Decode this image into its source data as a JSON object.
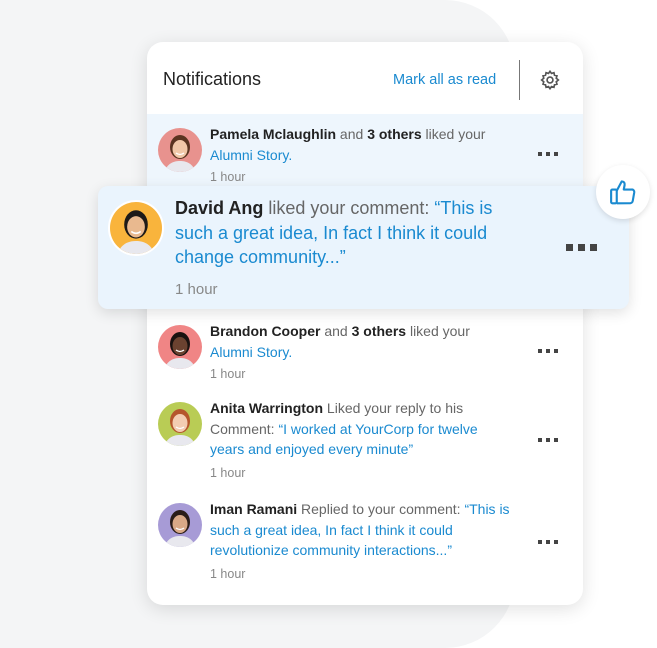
{
  "header": {
    "title": "Notifications",
    "mark_all": "Mark all as read",
    "settings_icon": "gear-icon"
  },
  "colors": {
    "accent": "#1a8ad0",
    "highlight": "#eef6fd"
  },
  "notifications": [
    {
      "name": "Pamela Mclaughlin",
      "mid": " and ",
      "bold2": "3 others",
      "action": " liked your ",
      "link": "Alumni Story.",
      "time": "1 hour",
      "avatar_color": "#e8928e",
      "skin": "#f1c7a8",
      "hair": "#5a3320"
    },
    {
      "name": "David Ang",
      "action": " liked your comment: ",
      "link": "“This is such a great idea, In fact I think it could change community...”",
      "time": "1 hour",
      "avatar_color": "#f9b43c",
      "skin": "#e9b98f",
      "hair": "#1d1a18"
    },
    {
      "name": "Brandon Cooper",
      "mid": " and ",
      "bold2": "3 others",
      "action": " liked your ",
      "link": "Alumni Story.",
      "time": "1 hour",
      "avatar_color": "#f08585",
      "skin": "#6b4230",
      "hair": "#1a1210"
    },
    {
      "name": "Anita Warrington",
      "action": " Liked your reply to his Comment: ",
      "link": "“I worked at YourCorp for twelve years and enjoyed every minute”",
      "time": "1 hour",
      "avatar_color": "#b9cc55",
      "skin": "#f3cdb2",
      "hair": "#b5562c"
    },
    {
      "name": "Iman Ramani",
      "action": " Replied to your comment: ",
      "link": "“This is such a great idea, In fact I think it could revolutionize community interactions...”",
      "time": "1 hour",
      "avatar_color": "#a79bd6",
      "skin": "#d9a987",
      "hair": "#2a1d18"
    }
  ],
  "floating_icon": "thumbs-up-icon"
}
